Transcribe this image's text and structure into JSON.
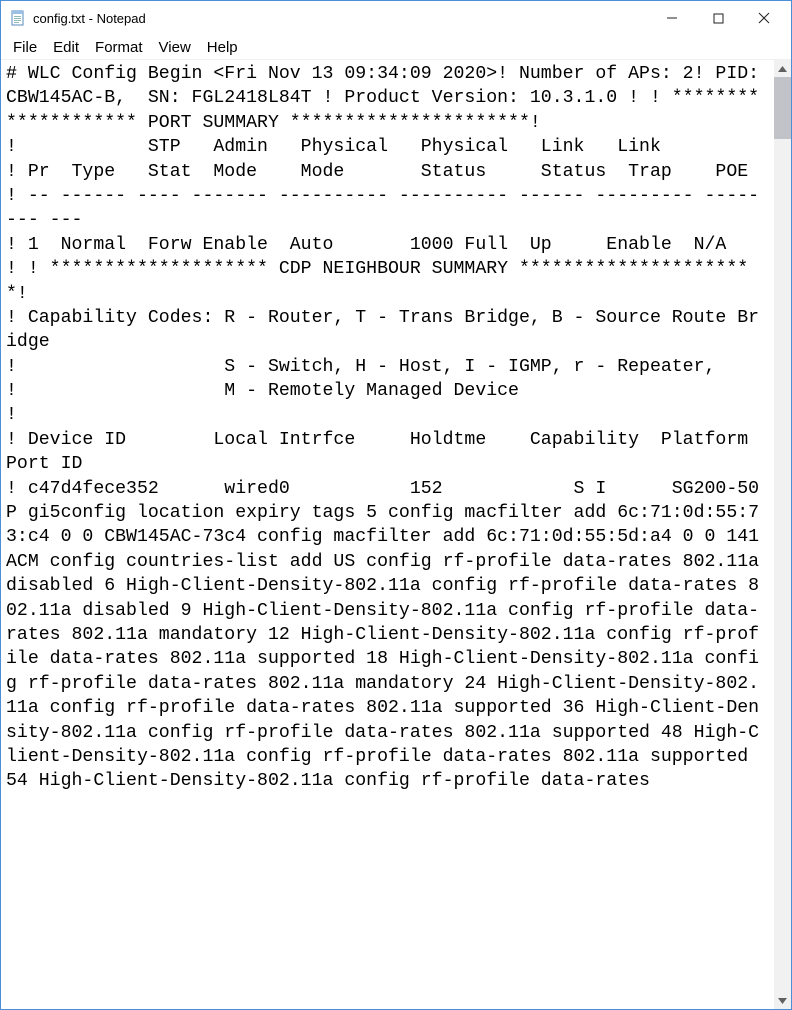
{
  "titlebar": {
    "title": "config.txt - Notepad"
  },
  "menubar": {
    "file": "File",
    "edit": "Edit",
    "format": "Format",
    "view": "View",
    "help": "Help"
  },
  "content": {
    "text": "# WLC Config Begin <Fri Nov 13 09:34:09 2020>! Number of APs: 2! PID: CBW145AC-B,  SN: FGL2418L84T ! Product Version: 10.3.1.0 ! ! ******************** PORT SUMMARY **********************!\n!            STP   Admin   Physical   Physical   Link   Link\n! Pr  Type   Stat  Mode    Mode       Status     Status  Trap    POE\n! -- ------ ---- ------- ---------- ---------- ------ --------- -------- ---\n! 1  Normal  Forw Enable  Auto       1000 Full  Up     Enable  N/A     ! ! ******************** CDP NEIGHBOUR SUMMARY **********************!\n! Capability Codes: R - Router, T - Trans Bridge, B - Source Route Bridge\n!                   S - Switch, H - Host, I - IGMP, r - Repeater,\n!                   M - Remotely Managed Device\n!\n! Device ID        Local Intrfce     Holdtme    Capability  Platform  Port ID\n! c47d4fece352      wired0           152            S I      SG200-50P gi5config location expiry tags 5 config macfilter add 6c:71:0d:55:73:c4 0 0 CBW145AC-73c4 config macfilter add 6c:71:0d:55:5d:a4 0 0 141ACM config countries-list add US config rf-profile data-rates 802.11a disabled 6 High-Client-Density-802.11a config rf-profile data-rates 802.11a disabled 9 High-Client-Density-802.11a config rf-profile data-rates 802.11a mandatory 12 High-Client-Density-802.11a config rf-profile data-rates 802.11a supported 18 High-Client-Density-802.11a config rf-profile data-rates 802.11a mandatory 24 High-Client-Density-802.11a config rf-profile data-rates 802.11a supported 36 High-Client-Density-802.11a config rf-profile data-rates 802.11a supported 48 High-Client-Density-802.11a config rf-profile data-rates 802.11a supported 54 High-Client-Density-802.11a config rf-profile data-rates"
  }
}
